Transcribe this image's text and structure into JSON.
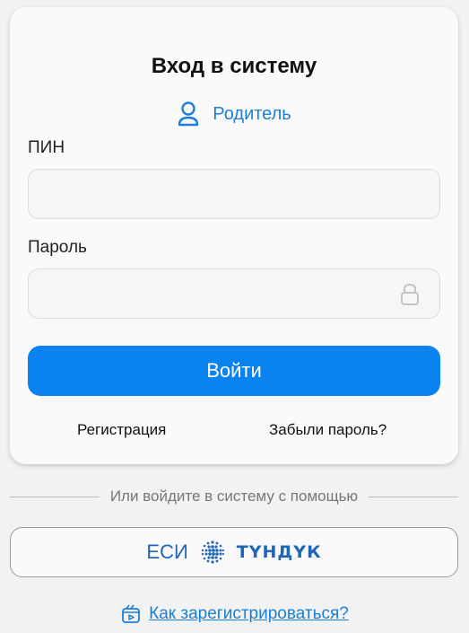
{
  "form": {
    "title": "Вход в систему",
    "role_label": "Родитель",
    "pin_label": "ПИН",
    "pin_value": "",
    "password_label": "Пароль",
    "password_value": "",
    "login_label": "Войти",
    "register_label": "Регистрация",
    "forgot_label": "Забыли пароль?"
  },
  "alt_login": {
    "divider_text": "Или войдите в систему с помощью",
    "esi_label": "ЕСИ",
    "tunduk_label": "ТҮНДҮК"
  },
  "help": {
    "how_to_register_label": "Как зарегистрироваться?"
  },
  "icons": {
    "role": "user-icon",
    "password": "lock-icon",
    "esi": "globe-icon",
    "help": "video-play-icon"
  },
  "colors": {
    "accent": "#0a82f0",
    "link": "#1a7fd9",
    "brand_esi": "#1f66b8"
  }
}
